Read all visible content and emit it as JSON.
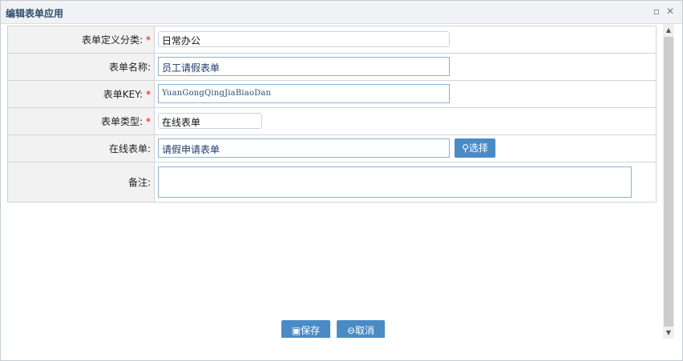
{
  "window": {
    "title": "编辑表单应用",
    "restore_icon": "restore-icon",
    "close_icon": "close-icon",
    "restore_glyph": "▫",
    "close_glyph": "✕"
  },
  "form": {
    "category": {
      "label": "表单定义分类:",
      "required": "*",
      "value": "日常办公"
    },
    "name": {
      "label": "表单名称:",
      "value": "员工请假表单"
    },
    "key": {
      "label": "表单KEY:",
      "required": "*",
      "value": "YuanGongQingJiaBiaoDan"
    },
    "type": {
      "label": "表单类型:",
      "required": "*",
      "value": "在线表单"
    },
    "online_form": {
      "label": "在线表单:",
      "value": "请假申请表单",
      "choose_label": "选择",
      "choose_icon": "search-icon"
    },
    "remark": {
      "label": "备注:",
      "value": ""
    }
  },
  "actions": {
    "save_label": "保存",
    "save_icon": "save-icon",
    "cancel_label": "取消",
    "cancel_icon": "cancel-icon"
  },
  "colors": {
    "accent": "#4a8bc6",
    "required": "#e00000",
    "label_bg": "#f2f2f2"
  }
}
